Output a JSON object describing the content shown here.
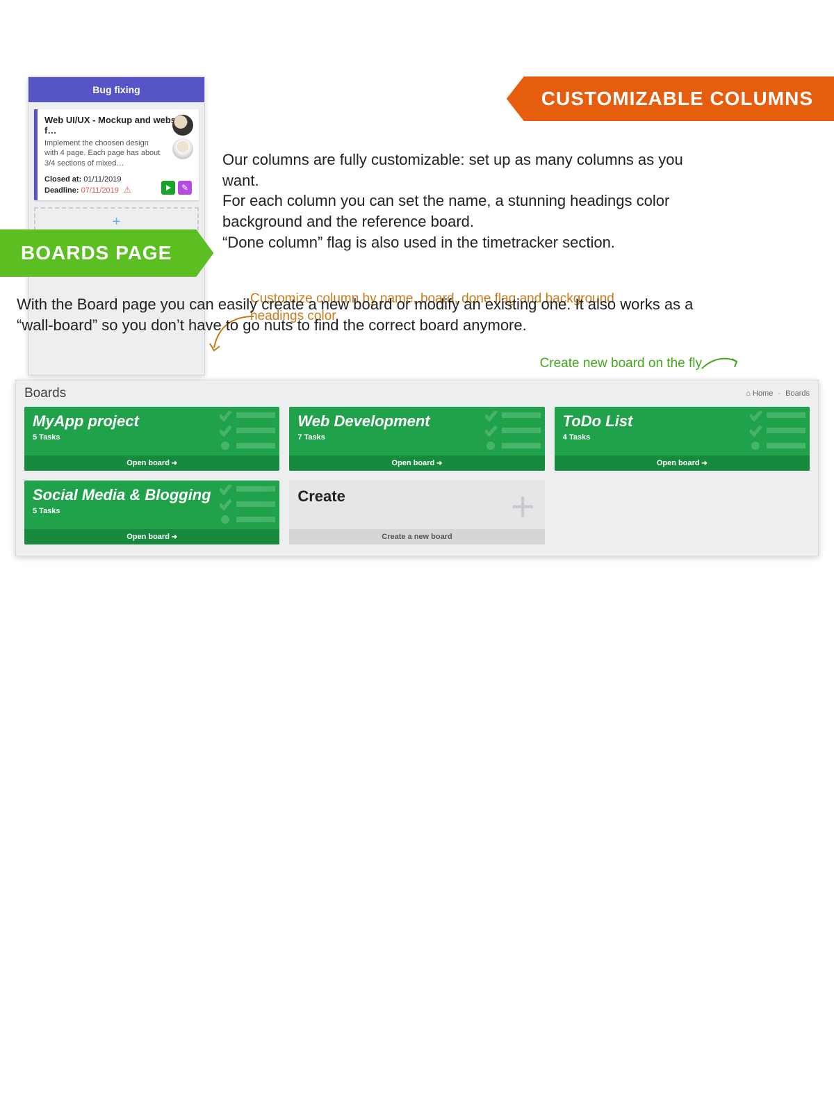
{
  "section1": {
    "badge": "CUSTOMIZABLE COLUMNS",
    "paragraph": "Our columns are fully customizable: set up as many columns as you want.\nFor each column you can set the name, a stunning headings color background and the reference board.\n“Done column” flag is also used in the timetracker section.",
    "caption": "Customize column by name, board, done flag and background headings color."
  },
  "column": {
    "header": "Bug fixing",
    "task": {
      "title": "Web UI/UX - Mockup and website f…",
      "description": "Implement the choosen design with 4 page. Each page has about 3/4 sections of mixed…",
      "closed_label": "Closed at:",
      "closed_value": "01/11/2019",
      "deadline_label": "Deadline:",
      "deadline_value": "07/11/2019"
    },
    "add_label": "+"
  },
  "section2": {
    "badge": "BOARDS PAGE",
    "paragraph": "With the Board page you can easily create a new board or modify an existing one. It also works as a “wall-board” so you don’t have to go nuts to find the correct board anymore.",
    "caption": "Create new board on the fly"
  },
  "boards_panel": {
    "title": "Boards",
    "breadcrumb_home": "Home",
    "breadcrumb_current": "Boards",
    "open_label": "Open board",
    "create_title": "Create",
    "create_footer": "Create a new board",
    "cards": [
      {
        "name": "MyApp project",
        "tasks": "5 Tasks"
      },
      {
        "name": "Web Development",
        "tasks": "7 Tasks"
      },
      {
        "name": "ToDo List",
        "tasks": "4 Tasks"
      },
      {
        "name": "Social Media & Blogging",
        "tasks": "5 Tasks"
      }
    ]
  }
}
